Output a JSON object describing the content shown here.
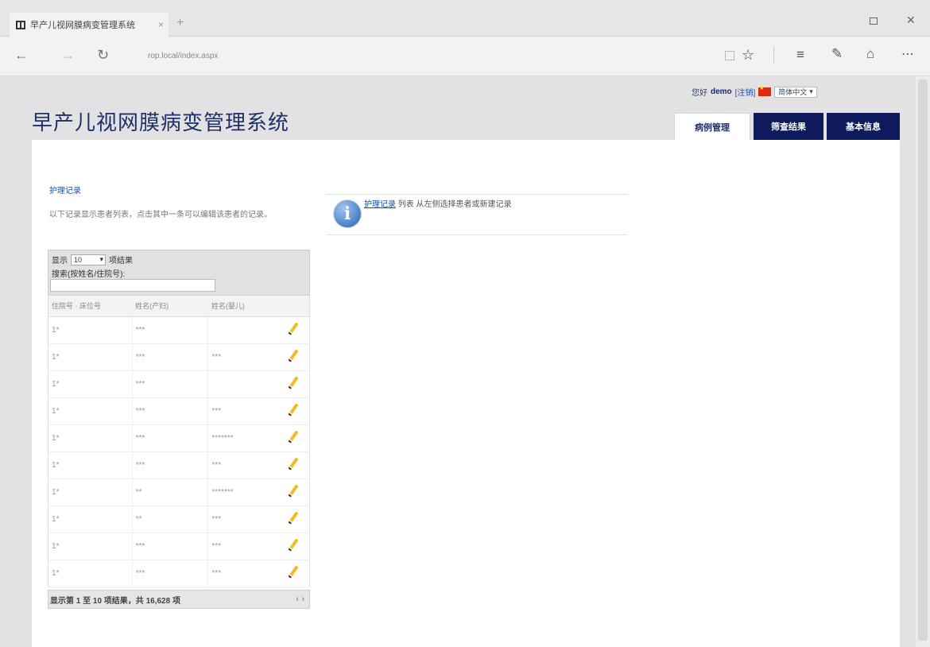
{
  "browser": {
    "tab_title": "早产儿视网膜病变管理系统",
    "tab_close": "×",
    "new_tab": "+",
    "url": "rop.local/index.aspx",
    "icons": [
      "tab-favicon-icon",
      "close-icon",
      "plus-icon",
      "restore-icon",
      "window-close-icon",
      "back-arrow-icon",
      "forward-arrow-icon",
      "refresh-icon",
      "reading-view-icon",
      "star-icon",
      "hub-icon",
      "web-note-icon",
      "share-icon",
      "more-icon"
    ]
  },
  "header": {
    "user_prefix": "您好",
    "user_name": "demo",
    "logout": "[注销]",
    "language": "简体中文",
    "app_title": "早产儿视网膜病变管理系统"
  },
  "tabs": [
    {
      "label": "病例管理",
      "active": true
    },
    {
      "label": "筛查结果",
      "active": false
    },
    {
      "label": "基本信息",
      "active": false
    }
  ],
  "sidebar": {
    "link": "护理记录",
    "description": "以下记录显示患者列表，点击其中一条可以编辑该患者的记录。"
  },
  "info": {
    "link_text": "护理记录",
    "message": "列表 从左侧选择患者或新建记录"
  },
  "grid": {
    "show_label": "显示",
    "page_size": "10",
    "per_page_label": "项结果",
    "search_label": "搜索(按姓名/住院号):",
    "columns": [
      "住院号 · 床位号",
      "姓名(产妇)",
      "姓名(婴儿)",
      ""
    ],
    "rows": [
      [
        "1*",
        "***",
        ""
      ],
      [
        "1*",
        "***",
        "***"
      ],
      [
        "1*",
        "***",
        ""
      ],
      [
        "1*",
        "***",
        "***"
      ],
      [
        "1*",
        "***",
        "*******"
      ],
      [
        "1*",
        "***",
        "***"
      ],
      [
        "1*",
        "**",
        "*******"
      ],
      [
        "1*",
        "**",
        "***"
      ],
      [
        "1*",
        "***",
        "***"
      ],
      [
        "1*",
        "***",
        "***"
      ]
    ],
    "footer": "显示第 1 至 10 项结果，共 16,628 项",
    "pager_prev": "‹",
    "pager_next": "›"
  }
}
